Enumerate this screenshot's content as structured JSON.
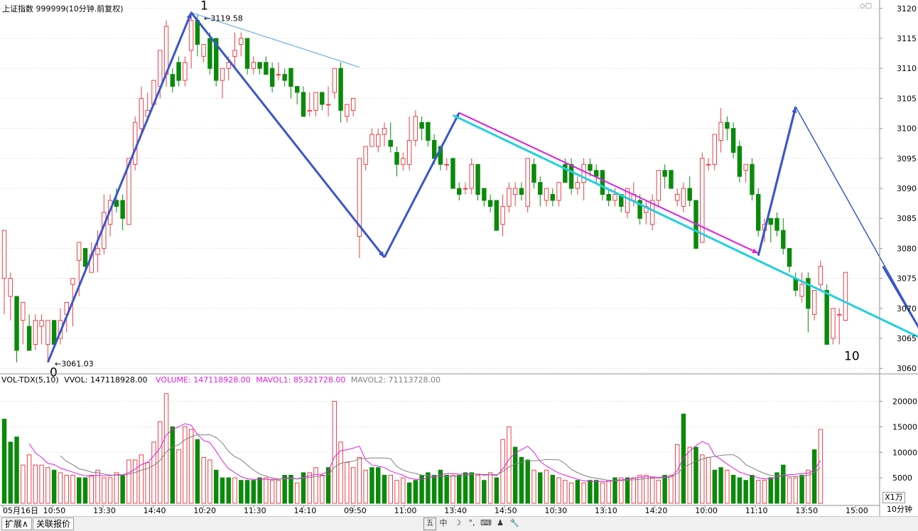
{
  "header": {
    "title": "上证指数 999999(10分钟.前复权)"
  },
  "vol_header": {
    "indicator": "VOL-TDX(5,10)",
    "vvol": "VVOL: 147118928.00",
    "volume": "VOLUME: 147118928.00",
    "mavol1": "MAVOL1: 85321728.00",
    "mavol2": "MAVOL2: 71113728.00"
  },
  "tabs": {
    "expand": "扩展∧",
    "related": "关联报价"
  },
  "toolbar": {
    "i1": "五",
    "i2": "中",
    "i3": "☽",
    "i4": "°,",
    "i5": "⌨",
    "i6": "♟",
    "i7": "🔧"
  },
  "side": {
    "unit": "X1万",
    "period": "10分钟"
  },
  "colors": {
    "up": "#e8404a",
    "down": "#0a8a0a",
    "wave": "#3a56cc",
    "magenta": "#e020e0",
    "cyan": "#20d0e0",
    "lightblue": "#6ab0e8",
    "mavol1": "#e020e0",
    "mavol2": "#808080",
    "grid": "#c8c8c8"
  },
  "chart_data": {
    "type": "candlestick",
    "price_axis": {
      "ticks": [
        3060,
        3065,
        3070,
        3075,
        3080,
        3085,
        3090,
        3095,
        3100,
        3105,
        3110,
        3115,
        3120
      ],
      "ylim": [
        3059.2,
        3121.4
      ]
    },
    "volume_axis": {
      "ticks": [
        5000,
        10000,
        15000,
        20000
      ],
      "unit": "X1万",
      "ylim": [
        0,
        23000
      ]
    },
    "x_labels": [
      "05月16日",
      "10:50",
      "13:30",
      "14:40",
      "10:20",
      "11:30",
      "14:10",
      "09:50",
      "11:00",
      "13:40",
      "14:50",
      "10:30",
      "13:10",
      "14:20",
      "10:00",
      "11:10",
      "13:50",
      "15:00"
    ],
    "candles": [
      [
        3075,
        3083,
        3069,
        3083
      ],
      [
        3072,
        3076,
        3068,
        3075
      ],
      [
        3072,
        3072,
        3061,
        3063
      ],
      [
        3068,
        3070,
        3064,
        3071
      ],
      [
        3067,
        3069,
        3063,
        3063
      ],
      [
        3064,
        3069,
        3063,
        3068
      ],
      [
        3067,
        3069,
        3064,
        3068
      ],
      [
        3064,
        3068,
        3061,
        3068
      ],
      [
        3068,
        3068,
        3064,
        3064
      ],
      [
        3065,
        3070,
        3064,
        3068
      ],
      [
        3069,
        3071,
        3066,
        3071
      ],
      [
        3074,
        3075,
        3067,
        3075
      ],
      [
        3078,
        3081,
        3072,
        3081
      ],
      [
        3080,
        3080,
        3076,
        3077
      ],
      [
        3076,
        3081,
        3076,
        3079
      ],
      [
        3079,
        3083,
        3076,
        3080
      ],
      [
        3080,
        3089,
        3079,
        3086
      ],
      [
        3084,
        3089,
        3082,
        3088
      ],
      [
        3088,
        3090,
        3086,
        3087
      ],
      [
        3088,
        3089,
        3083,
        3085
      ],
      [
        3084,
        3095,
        3084,
        3095
      ],
      [
        3094,
        3102,
        3093,
        3101
      ],
      [
        3100,
        3107,
        3099,
        3105
      ],
      [
        3102,
        3106,
        3101,
        3103
      ],
      [
        3104,
        3108,
        3104,
        3108
      ],
      [
        3107,
        3113,
        3105,
        3113
      ],
      [
        3109,
        3118,
        3107,
        3117
      ],
      [
        3109,
        3110,
        3106,
        3107
      ],
      [
        3111,
        3112,
        3107,
        3108
      ],
      [
        3108,
        3112,
        3107,
        3111
      ],
      [
        3113,
        3119.58,
        3110,
        3118
      ],
      [
        3118,
        3119,
        3112,
        3114
      ],
      [
        3112,
        3114,
        3111,
        3114
      ],
      [
        3115,
        3116,
        3109,
        3110
      ],
      [
        3115,
        3115,
        3107,
        3108
      ],
      [
        3108,
        3109,
        3105,
        3110
      ],
      [
        3110,
        3112,
        3108,
        3111
      ],
      [
        3112,
        3116,
        3110,
        3113
      ],
      [
        3114,
        3116,
        3112,
        3115
      ],
      [
        3115,
        3115,
        3109,
        3110
      ],
      [
        3110,
        3112,
        3109,
        3111
      ],
      [
        3111,
        3111,
        3109,
        3110
      ],
      [
        3111,
        3112,
        3109,
        3109
      ],
      [
        3110,
        3111,
        3106,
        3107
      ],
      [
        3109,
        3111,
        3108,
        3109
      ],
      [
        3109,
        3110,
        3107,
        3108
      ],
      [
        3110,
        3110,
        3105,
        3107
      ],
      [
        3107,
        3107,
        3104,
        3106
      ],
      [
        3106,
        3107,
        3102,
        3102
      ],
      [
        3103,
        3106,
        3102,
        3103
      ],
      [
        3103,
        3106,
        3102,
        3106
      ],
      [
        3106,
        3106,
        3103,
        3104
      ],
      [
        3104,
        3107,
        3102,
        3104
      ],
      [
        3106,
        3110,
        3105,
        3110
      ],
      [
        3110,
        3111,
        3101,
        3103
      ],
      [
        3102,
        3104,
        3101,
        3104
      ],
      [
        3103,
        3104,
        3102,
        3105
      ],
      [
        3082,
        3083,
        3078.4,
        3095
      ],
      [
        3094,
        3097,
        3093,
        3097
      ],
      [
        3097,
        3100,
        3097,
        3099
      ],
      [
        3097,
        3100,
        3096,
        3099
      ],
      [
        3099,
        3101,
        3097,
        3100
      ],
      [
        3098,
        3101,
        3096,
        3097
      ],
      [
        3096,
        3097,
        3092,
        3094
      ],
      [
        3094,
        3096,
        3093,
        3095
      ],
      [
        3094,
        3102,
        3093,
        3098
      ],
      [
        3098,
        3103,
        3097,
        3102
      ],
      [
        3101,
        3102,
        3098,
        3100
      ],
      [
        3101,
        3101,
        3097,
        3098
      ],
      [
        3098,
        3099,
        3094,
        3095
      ],
      [
        3097,
        3097,
        3093,
        3094
      ],
      [
        3094,
        3095,
        3093,
        3094
      ],
      [
        3095,
        3095,
        3090,
        3090
      ],
      [
        3090,
        3091,
        3088,
        3089
      ],
      [
        3090,
        3091,
        3089,
        3090
      ],
      [
        3090,
        3095,
        3089,
        3094
      ],
      [
        3094,
        3094,
        3088,
        3089
      ],
      [
        3090,
        3090,
        3087,
        3088
      ],
      [
        3088,
        3089,
        3086,
        3087
      ],
      [
        3088,
        3088,
        3083,
        3083
      ],
      [
        3084,
        3089,
        3082,
        3087
      ],
      [
        3087,
        3091,
        3086,
        3090
      ],
      [
        3089,
        3091,
        3087,
        3090
      ],
      [
        3090,
        3091,
        3088,
        3089
      ],
      [
        3087,
        3095,
        3086,
        3095
      ],
      [
        3094,
        3095,
        3090,
        3091
      ],
      [
        3091,
        3092,
        3087,
        3089
      ],
      [
        3088,
        3090,
        3087,
        3090
      ],
      [
        3089,
        3090,
        3087,
        3088
      ],
      [
        3088,
        3091,
        3087,
        3091
      ],
      [
        3094,
        3095,
        3091,
        3091
      ],
      [
        3094,
        3095,
        3089,
        3090
      ],
      [
        3090,
        3092,
        3089,
        3091
      ],
      [
        3091,
        3095,
        3088,
        3094
      ],
      [
        3094,
        3095,
        3092,
        3093
      ],
      [
        3093,
        3094,
        3091,
        3092
      ],
      [
        3093,
        3093,
        3088,
        3089
      ],
      [
        3089,
        3090,
        3087,
        3088
      ],
      [
        3088,
        3090,
        3087,
        3089
      ],
      [
        3089,
        3089,
        3086,
        3087
      ],
      [
        3086,
        3090,
        3085,
        3090
      ],
      [
        3088,
        3091,
        3087,
        3089
      ],
      [
        3088,
        3089,
        3084,
        3085
      ],
      [
        3086,
        3088,
        3084,
        3087
      ],
      [
        3084,
        3089,
        3083,
        3088
      ],
      [
        3088,
        3093,
        3087,
        3093
      ],
      [
        3093,
        3094,
        3090,
        3092
      ],
      [
        3093,
        3093,
        3090,
        3090
      ],
      [
        3088,
        3090,
        3087,
        3089
      ],
      [
        3087,
        3091,
        3086,
        3090
      ],
      [
        3090,
        3092,
        3087,
        3088
      ],
      [
        3088,
        3088,
        3080,
        3080
      ],
      [
        3081,
        3096,
        3081,
        3095
      ],
      [
        3094,
        3095,
        3093,
        3094
      ],
      [
        3094,
        3099,
        3093,
        3099
      ],
      [
        3098,
        3103.4,
        3096,
        3101
      ],
      [
        3101,
        3102,
        3098,
        3100
      ],
      [
        3100,
        3101,
        3095,
        3096
      ],
      [
        3097,
        3098,
        3091,
        3092
      ],
      [
        3093,
        3094,
        3091,
        3094
      ],
      [
        3094,
        3095,
        3088,
        3089
      ],
      [
        3089,
        3090,
        3082,
        3083
      ],
      [
        3083,
        3085,
        3081,
        3084
      ],
      [
        3085,
        3085,
        3081,
        3084
      ],
      [
        3085,
        3086,
        3082,
        3083
      ],
      [
        3083,
        3085,
        3079,
        3080
      ],
      [
        3080,
        3080,
        3076,
        3077
      ],
      [
        3075,
        3076,
        3072,
        3073
      ],
      [
        3072,
        3076,
        3071,
        3074
      ],
      [
        3075,
        3076,
        3066,
        3070
      ],
      [
        3069,
        3071,
        3068,
        3073
      ],
      [
        3074,
        3078,
        3073,
        3077
      ],
      [
        3073,
        3074,
        3064,
        3064
      ],
      [
        3065,
        3070,
        3064,
        3070
      ],
      [
        3069,
        3070,
        3064,
        3069
      ],
      [
        3068,
        3076,
        3068,
        3076
      ]
    ],
    "volumes": [
      [
        16500,
        0
      ],
      [
        12000,
        0
      ],
      [
        13000,
        0
      ],
      [
        7500,
        1
      ],
      [
        9500,
        1
      ],
      [
        7500,
        1
      ],
      [
        7500,
        1
      ],
      [
        7000,
        1
      ],
      [
        6500,
        0
      ],
      [
        6000,
        1
      ],
      [
        5500,
        1
      ],
      [
        5500,
        1
      ],
      [
        5000,
        0
      ],
      [
        5000,
        0
      ],
      [
        5500,
        1
      ],
      [
        6500,
        1
      ],
      [
        5000,
        1
      ],
      [
        5000,
        1
      ],
      [
        6000,
        1
      ],
      [
        5500,
        0
      ],
      [
        8500,
        1
      ],
      [
        8500,
        1
      ],
      [
        9500,
        1
      ],
      [
        8000,
        1
      ],
      [
        12000,
        1
      ],
      [
        16000,
        1
      ],
      [
        21500,
        1
      ],
      [
        15000,
        0
      ],
      [
        10500,
        1
      ],
      [
        15000,
        1
      ],
      [
        14500,
        1
      ],
      [
        12500,
        0
      ],
      [
        9000,
        1
      ],
      [
        8500,
        1
      ],
      [
        6500,
        0
      ],
      [
        5000,
        0
      ],
      [
        5000,
        0
      ],
      [
        5000,
        1
      ],
      [
        4500,
        0
      ],
      [
        4500,
        0
      ],
      [
        4500,
        0
      ],
      [
        5000,
        0
      ],
      [
        5000,
        1
      ],
      [
        4500,
        1
      ],
      [
        4500,
        1
      ],
      [
        5500,
        0
      ],
      [
        5500,
        0
      ],
      [
        4000,
        1
      ],
      [
        6000,
        0
      ],
      [
        6000,
        1
      ],
      [
        7000,
        1
      ],
      [
        5500,
        1
      ],
      [
        7000,
        0
      ],
      [
        20000,
        1
      ],
      [
        12000,
        1
      ],
      [
        8000,
        1
      ],
      [
        7000,
        1
      ],
      [
        9000,
        1
      ],
      [
        6500,
        1
      ],
      [
        7000,
        0
      ],
      [
        7000,
        0
      ],
      [
        5500,
        0
      ],
      [
        5500,
        1
      ],
      [
        4500,
        1
      ],
      [
        5000,
        1
      ],
      [
        4000,
        0
      ],
      [
        4500,
        0
      ],
      [
        5500,
        0
      ],
      [
        6000,
        0
      ],
      [
        5500,
        0
      ],
      [
        6500,
        0
      ],
      [
        5500,
        0
      ],
      [
        5500,
        1
      ],
      [
        5500,
        0
      ],
      [
        6000,
        0
      ],
      [
        6000,
        0
      ],
      [
        5500,
        1
      ],
      [
        4500,
        0
      ],
      [
        6000,
        1
      ],
      [
        5000,
        0
      ],
      [
        12500,
        1
      ],
      [
        15000,
        1
      ],
      [
        11000,
        0
      ],
      [
        9000,
        0
      ],
      [
        8500,
        0
      ],
      [
        6500,
        1
      ],
      [
        6000,
        0
      ],
      [
        6500,
        1
      ],
      [
        5500,
        0
      ],
      [
        5000,
        1
      ],
      [
        4500,
        1
      ],
      [
        4000,
        1
      ],
      [
        4500,
        0
      ],
      [
        4000,
        1
      ],
      [
        4500,
        0
      ],
      [
        4500,
        0
      ],
      [
        4000,
        1
      ],
      [
        4500,
        1
      ],
      [
        5000,
        0
      ],
      [
        5000,
        1
      ],
      [
        5000,
        0
      ],
      [
        5000,
        1
      ],
      [
        5500,
        1
      ],
      [
        5500,
        1
      ],
      [
        5000,
        1
      ],
      [
        4500,
        1
      ],
      [
        5500,
        0
      ],
      [
        5500,
        1
      ],
      [
        11500,
        1
      ],
      [
        17500,
        0
      ],
      [
        11000,
        1
      ],
      [
        11000,
        0
      ],
      [
        9500,
        1
      ],
      [
        9000,
        1
      ],
      [
        6500,
        0
      ],
      [
        7000,
        0
      ],
      [
        6500,
        1
      ],
      [
        5500,
        0
      ],
      [
        5000,
        0
      ],
      [
        4500,
        0
      ],
      [
        5500,
        0
      ],
      [
        4500,
        1
      ],
      [
        4500,
        1
      ],
      [
        5000,
        0
      ],
      [
        6000,
        0
      ],
      [
        7500,
        0
      ],
      [
        5000,
        1
      ],
      [
        5000,
        1
      ],
      [
        5500,
        0
      ],
      [
        6500,
        1
      ],
      [
        10500,
        0
      ],
      [
        14500,
        1
      ]
    ],
    "annotations": {
      "wave_labels": [
        "0",
        "1",
        "10"
      ],
      "low_price": "3061.03",
      "high_price": "3119.58"
    }
  }
}
